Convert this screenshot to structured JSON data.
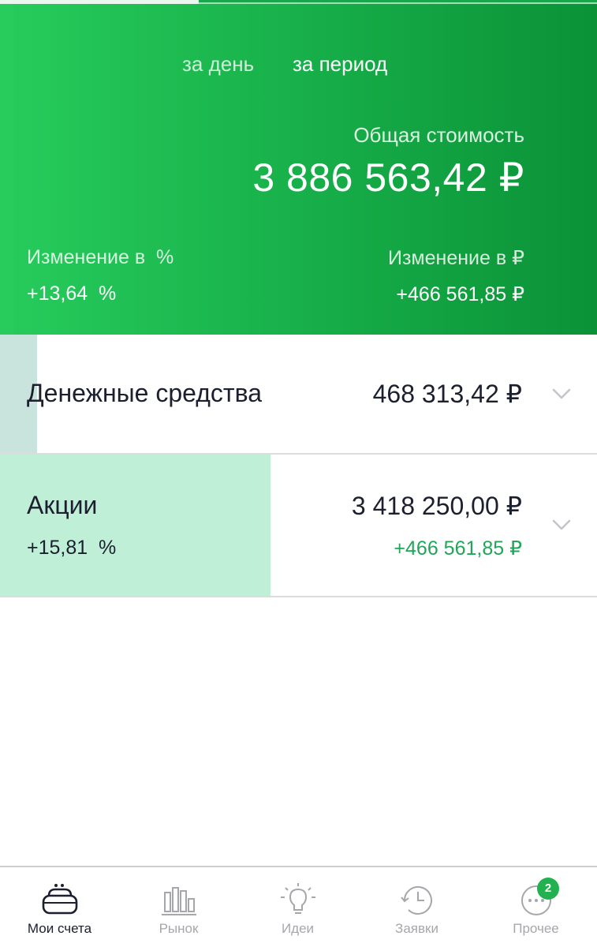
{
  "header": {
    "progress_fraction": 0.333,
    "tabs": [
      {
        "label": "за день",
        "active": false
      },
      {
        "label": "за период",
        "active": true
      }
    ],
    "total_label": "Общая стоимость",
    "total_value": "3 886 563,42 ₽",
    "change_pct_label": "Изменение в  %",
    "change_pct_value": "+13,64  %",
    "change_rub_label": "Изменение в ₽",
    "change_rub_value": "+466 561,85 ₽"
  },
  "assets": [
    {
      "name": "Денежные средства",
      "amount": "468 313,42 ₽",
      "share_fraction": 0.062,
      "chevron_icon": "chevron-down-icon"
    },
    {
      "name": "Акции",
      "amount": "3 418 250,00 ₽",
      "pct": "+15,81  %",
      "change": "+466 561,85 ₽",
      "share_fraction": 0.453,
      "chevron_icon": "chevron-down-icon"
    }
  ],
  "nav": {
    "items": [
      {
        "label": "Мои счета",
        "icon": "wallet-icon",
        "active": true
      },
      {
        "label": "Рынок",
        "icon": "market-chart-icon",
        "active": false
      },
      {
        "label": "Идеи",
        "icon": "lightbulb-icon",
        "active": false
      },
      {
        "label": "Заявки",
        "icon": "history-clock-icon",
        "active": false
      },
      {
        "label": "Прочее",
        "icon": "more-dots-icon",
        "active": false,
        "badge": "2"
      }
    ]
  },
  "colors": {
    "header_gradient_start": "#27cc5c",
    "header_gradient_end": "#0b9237",
    "positive_change": "#21a558",
    "badge": "#21b24f",
    "text_dark": "#1b1f2e",
    "nav_inactive": "#a5a7ab"
  }
}
